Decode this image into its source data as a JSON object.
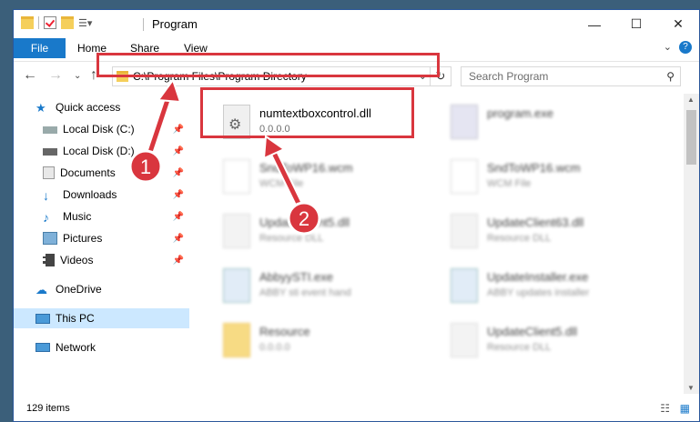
{
  "window": {
    "title": "Program"
  },
  "ribbon": {
    "file": "File",
    "home": "Home",
    "share": "Share",
    "view": "View"
  },
  "address": {
    "path": "C:\\Program Files\\Program Directory"
  },
  "search": {
    "placeholder": "Search Program"
  },
  "sidebar": {
    "items": [
      {
        "label": "Quick access"
      },
      {
        "label": "Local Disk (C:)"
      },
      {
        "label": "Local Disk (D:)"
      },
      {
        "label": "Documents"
      },
      {
        "label": "Downloads"
      },
      {
        "label": "Music"
      },
      {
        "label": "Pictures"
      },
      {
        "label": "Videos"
      },
      {
        "label": "OneDrive"
      },
      {
        "label": "This PC"
      },
      {
        "label": "Network"
      }
    ]
  },
  "files": [
    {
      "name": "numtextboxcontrol.dll",
      "type": "0.0.0.0"
    },
    {
      "name": "program.exe",
      "type": ""
    },
    {
      "name": "SndToWP16.wcm",
      "type": "WCM File"
    },
    {
      "name": "SndToWP16.wcm",
      "type": "WCM File"
    },
    {
      "name": "UpdateClient5.dll",
      "type": "Resource DLL"
    },
    {
      "name": "UpdateClient63.dll",
      "type": "Resource DLL"
    },
    {
      "name": "AbbyySTI.exe",
      "type": "ABBY sti event hand"
    },
    {
      "name": "UpdateInstaller.exe",
      "type": "ABBY updates installer"
    },
    {
      "name": "Resource",
      "type": "0.0.0.0"
    },
    {
      "name": "UpdateClient5.dll",
      "type": "Resource DLL"
    }
  ],
  "status": {
    "items": "129 items"
  },
  "callouts": {
    "one": "1",
    "two": "2"
  },
  "colors": {
    "accent": "#1979ca",
    "highlight": "#d9363e"
  }
}
